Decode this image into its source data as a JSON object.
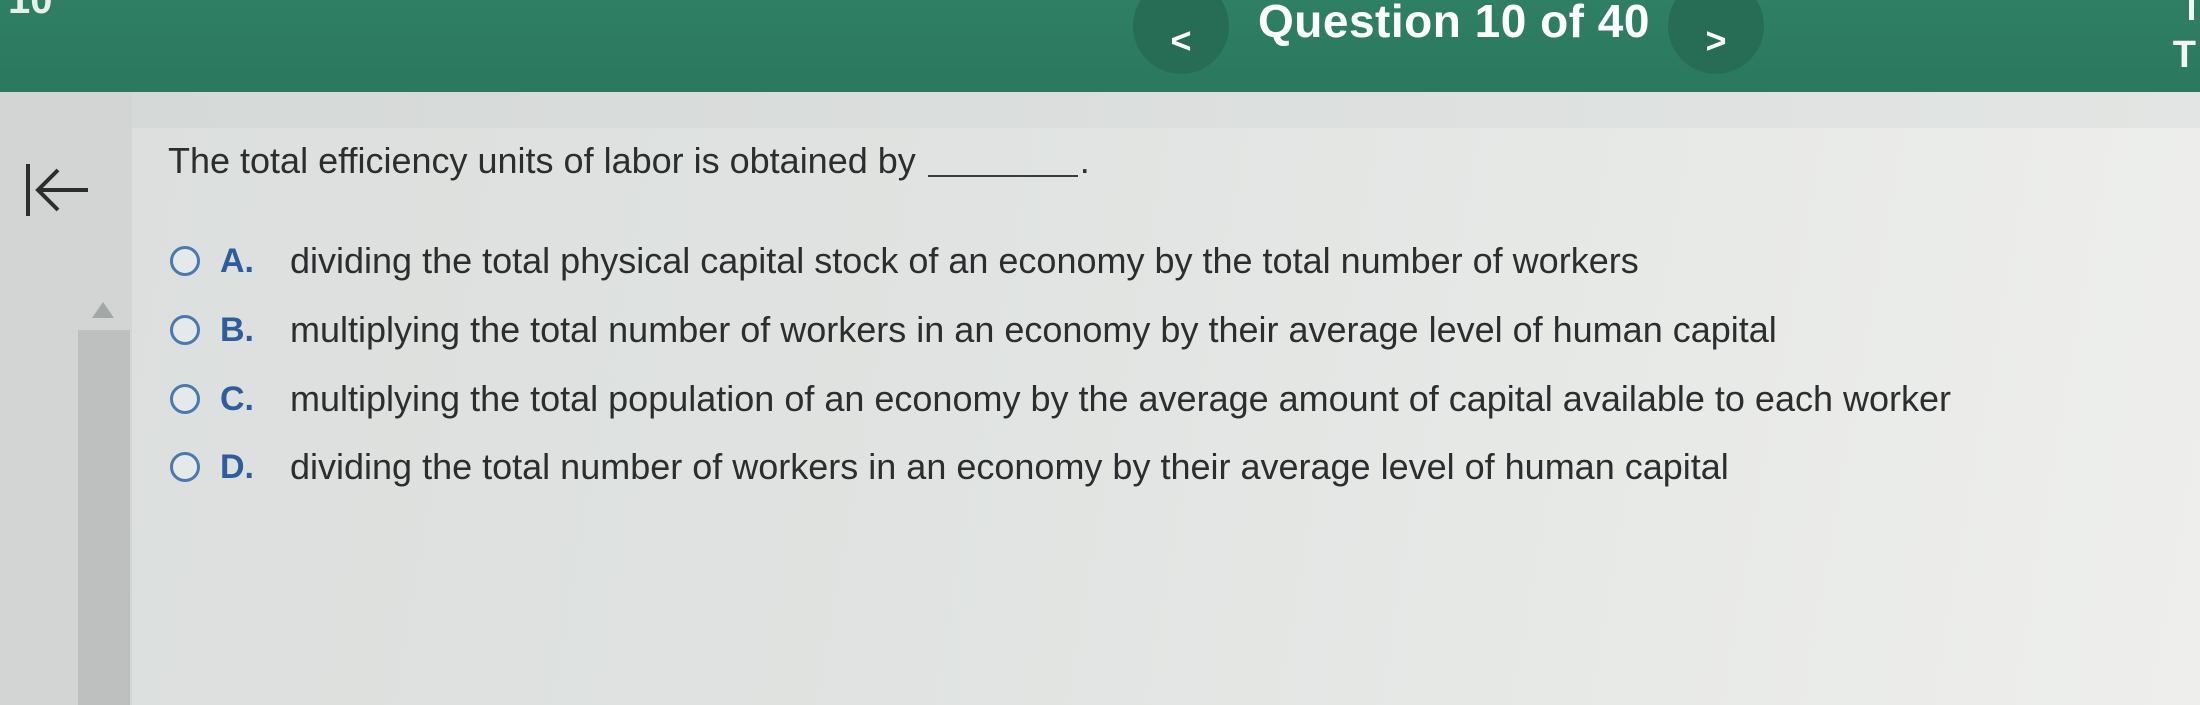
{
  "header": {
    "corner_text": "10",
    "prev_label": "<",
    "question_counter": "Question 10 of 40",
    "next_label": ">",
    "right_edge_text": "T"
  },
  "sidebar": {
    "collapse_icon": "collapse-left-icon",
    "scroll_up_icon": "scroll-up-arrow-icon"
  },
  "question": {
    "text": "The total efficiency units of labor is obtained by",
    "period": ".",
    "options": [
      {
        "letter": "A.",
        "text": "dividing the total physical capital stock of an economy by the total number of workers"
      },
      {
        "letter": "B.",
        "text": "multiplying the total number of workers in an economy by their average level of human capital"
      },
      {
        "letter": "C.",
        "text": "multiplying the total population of an economy by the average amount of capital available to each worker"
      },
      {
        "letter": "D.",
        "text": "dividing the total number of workers in an economy by their average level of human capital"
      }
    ]
  },
  "colors": {
    "header_green": "#2b7a5f",
    "option_letter_blue": "#2d5d9a",
    "radio_border_blue": "#4a78b0"
  }
}
